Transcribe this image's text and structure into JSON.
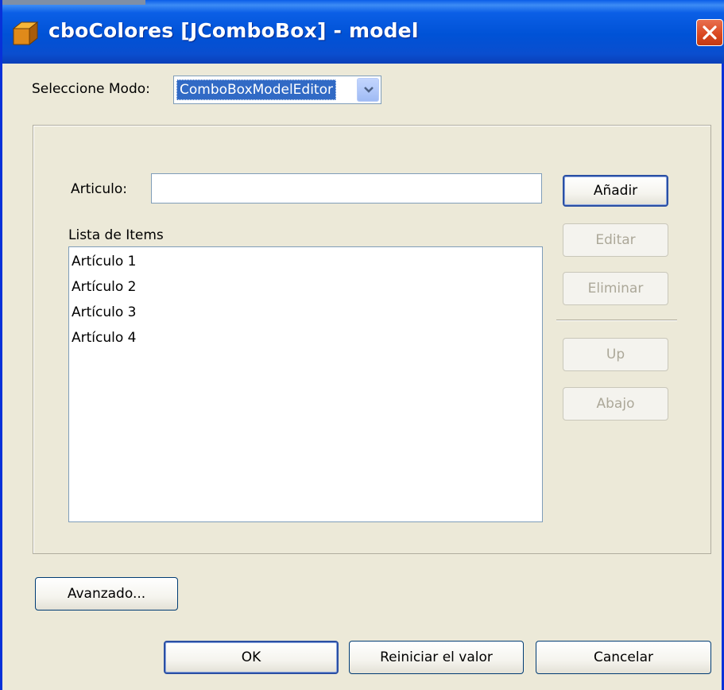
{
  "window": {
    "title": "cboColores [JComboBox] - model"
  },
  "mode": {
    "label": "Seleccione Modo:",
    "selected": "ComboBoxModelEditor"
  },
  "editor": {
    "article_label": "Articulo:",
    "article_value": "",
    "list_label": "Lista de Items",
    "items": [
      "Artículo 1",
      "Artículo 2",
      "Artículo 3",
      "Artículo 4"
    ],
    "buttons": {
      "add": "Añadir",
      "edit": "Editar",
      "delete": "Eliminar",
      "up": "Up",
      "down": "Abajo"
    }
  },
  "advanced_button": "Avanzado...",
  "footer": {
    "ok": "OK",
    "reset": "Reiniciar el valor",
    "cancel": "Cancelar"
  },
  "colors": {
    "titlebar": "#0052d6",
    "selection": "#316ac5",
    "close": "#d9461f",
    "background": "#ece9d8",
    "disabled_text": "#aca899"
  },
  "icons": {
    "window": "cube-icon",
    "close": "close-icon",
    "dropdown": "chevron-down-icon"
  }
}
